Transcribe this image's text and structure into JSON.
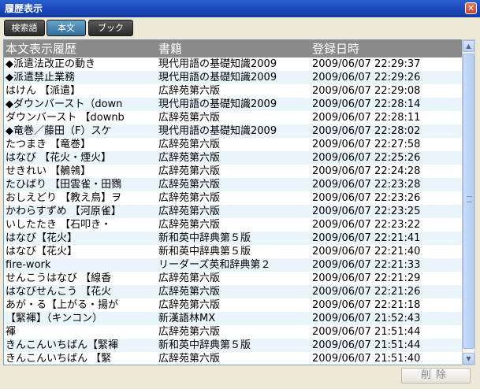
{
  "window": {
    "title": "履歴表示",
    "close_label": "✕"
  },
  "tabs": [
    {
      "label": "検索語"
    },
    {
      "label": "本文"
    },
    {
      "label": "ブック"
    }
  ],
  "table": {
    "headers": [
      "本文表示履歴",
      "書籍",
      "登録日時"
    ],
    "rows": [
      [
        "◆派遣法改正の動き",
        "現代用語の基礎知識2009",
        "2009/06/07  22:29:37"
      ],
      [
        "◆派遣禁止業務",
        "現代用語の基礎知識2009",
        "2009/06/07  22:29:26"
      ],
      [
        "はけん  【派遣】",
        "広辞苑第六版",
        "2009/06/07  22:29:08"
      ],
      [
        "◆ダウンバースト（down",
        "現代用語の基礎知識2009",
        "2009/06/07  22:28:14"
      ],
      [
        "ダウンバースト  【downb",
        "広辞苑第六版",
        "2009/06/07  22:28:11"
      ],
      [
        "◆竜巻／藤田（F）スケ",
        "現代用語の基礎知識2009",
        "2009/06/07  22:28:02"
      ],
      [
        "たつまき  【竜巻】",
        "広辞苑第六版",
        "2009/06/07  22:27:58"
      ],
      [
        "はなび  【花火・煙火】",
        "広辞苑第六版",
        "2009/06/07  22:25:26"
      ],
      [
        "せきれい  【鶺鴒】",
        "広辞苑第六版",
        "2009/06/07  22:24:28"
      ],
      [
        "たひばり  【田雲雀・田鷚",
        "広辞苑第六版",
        "2009/06/07  22:23:28"
      ],
      [
        "おしえどり  【教え鳥】ヲ",
        "広辞苑第六版",
        "2009/06/07  22:23:26"
      ],
      [
        "かわらすずめ  【河原雀】",
        "広辞苑第六版",
        "2009/06/07  22:23:25"
      ],
      [
        "いしたたき  【石叩き・",
        "広辞苑第六版",
        "2009/06/07  22:23:22"
      ],
      [
        "はなび【花火】",
        "新和英中辞典第５版",
        "2009/06/07  22:21:41"
      ],
      [
        "はなび【花火】",
        "新和英中辞典第５版",
        "2009/06/07  22:21:40"
      ],
      [
        "fire-work",
        "リーダーズ英和辞典第２",
        "2009/06/07  22:21:33"
      ],
      [
        "せんこうはなび  【線香",
        "広辞苑第六版",
        "2009/06/07  22:21:29"
      ],
      [
        "はなびせんこう  【花火",
        "広辞苑第六版",
        "2009/06/07  22:21:26"
      ],
      [
        "あが・る【上がる・揚が",
        "広辞苑第六版",
        "2009/06/07  22:21:18"
      ],
      [
        "【緊褌】（キンコン）",
        "新漢語林MX",
        "2009/06/07  21:52:43"
      ],
      [
        "褌",
        "広辞苑第六版",
        "2009/06/07  21:51:44"
      ],
      [
        "きんこんいちばん【緊褌",
        "新和英中辞典第５版",
        "2009/06/07  21:51:44"
      ],
      [
        "きんこんいちばん  【緊",
        "広辞苑第六版",
        "2009/06/07  21:51:40"
      ]
    ]
  },
  "scrollbar": {
    "up_icon": "▲",
    "down_icon": "▼"
  },
  "footer": {
    "delete_label": "削除"
  }
}
